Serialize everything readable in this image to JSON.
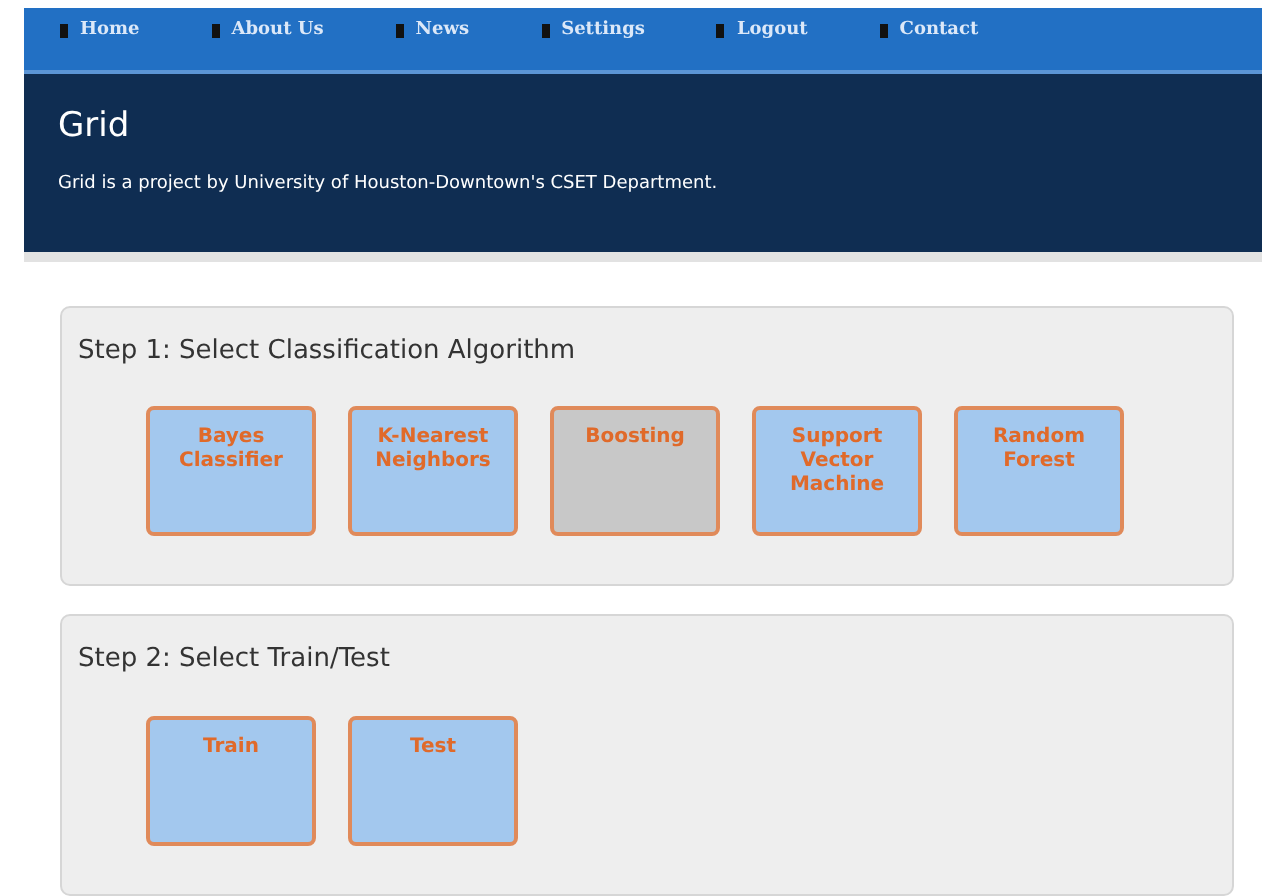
{
  "nav": [
    {
      "label": "Home"
    },
    {
      "label": "About Us"
    },
    {
      "label": "News"
    },
    {
      "label": "Settings"
    },
    {
      "label": "Logout"
    },
    {
      "label": "Contact"
    }
  ],
  "header": {
    "title": "Grid",
    "subtitle": "Grid is a project by University of Houston-Downtown's CSET Department."
  },
  "steps": [
    {
      "title": "Step 1: Select Classification Algorithm",
      "options": [
        {
          "label": "Bayes Classifier",
          "selected": false
        },
        {
          "label": "K-Nearest Neighbors",
          "selected": false
        },
        {
          "label": "Boosting",
          "selected": true
        },
        {
          "label": "Support Vector Machine",
          "selected": false
        },
        {
          "label": "Random Forest",
          "selected": false
        }
      ]
    },
    {
      "title": "Step 2: Select Train/Test",
      "options": [
        {
          "label": "Train",
          "selected": false
        },
        {
          "label": "Test",
          "selected": false
        }
      ]
    }
  ]
}
